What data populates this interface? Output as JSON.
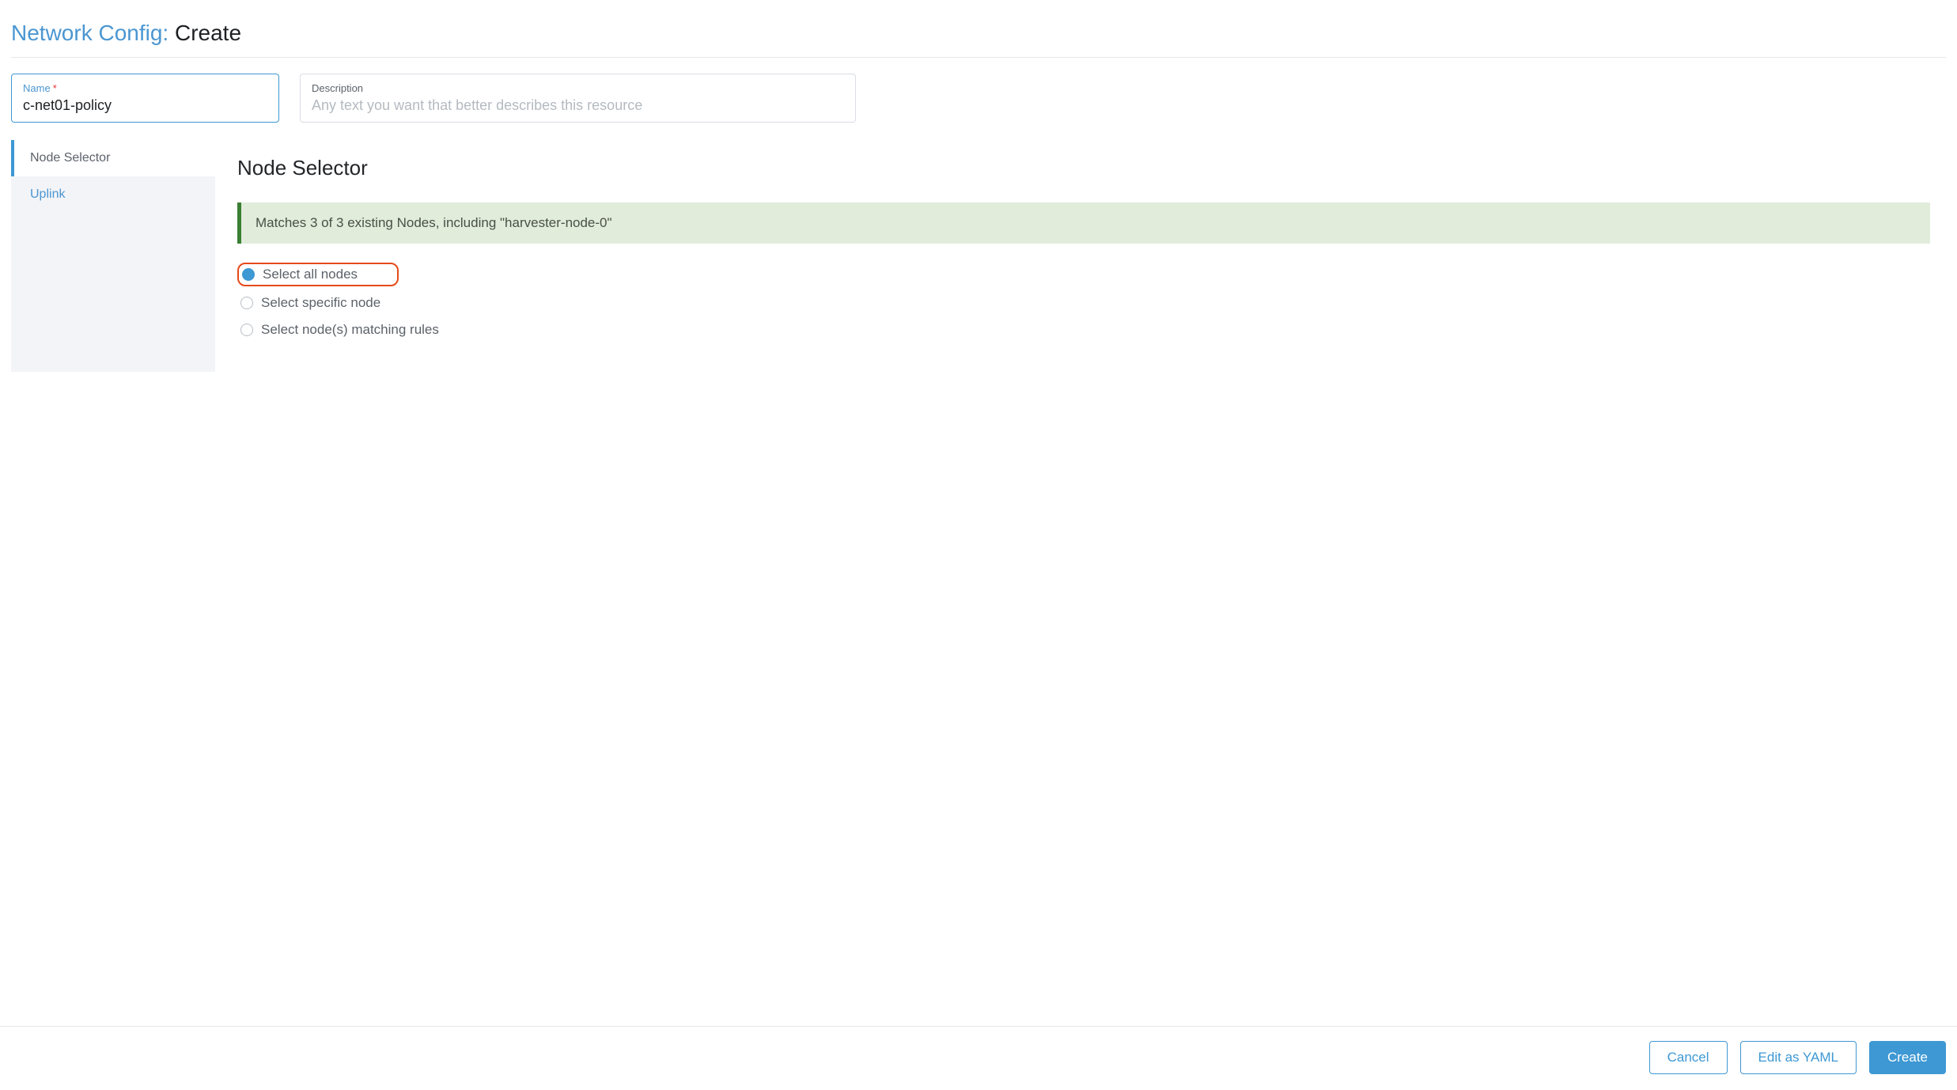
{
  "header": {
    "context": "Network Config:",
    "action": "Create"
  },
  "fields": {
    "name": {
      "label": "Name",
      "required_mark": "*",
      "value": "c-net01-policy"
    },
    "description": {
      "label": "Description",
      "placeholder": "Any text you want that better describes this resource",
      "value": ""
    }
  },
  "tabs": {
    "items": [
      {
        "label": "Node Selector",
        "active": true
      },
      {
        "label": "Uplink",
        "active": false
      }
    ]
  },
  "panel": {
    "heading": "Node Selector",
    "banner": "Matches 3 of 3 existing Nodes, including \"harvester-node-0\"",
    "radios": [
      {
        "label": "Select all nodes",
        "selected": true,
        "highlight": true
      },
      {
        "label": "Select specific node",
        "selected": false,
        "highlight": false
      },
      {
        "label": "Select node(s) matching rules",
        "selected": false,
        "highlight": false
      }
    ]
  },
  "buttons": {
    "cancel": "Cancel",
    "yaml": "Edit as YAML",
    "create": "Create"
  }
}
